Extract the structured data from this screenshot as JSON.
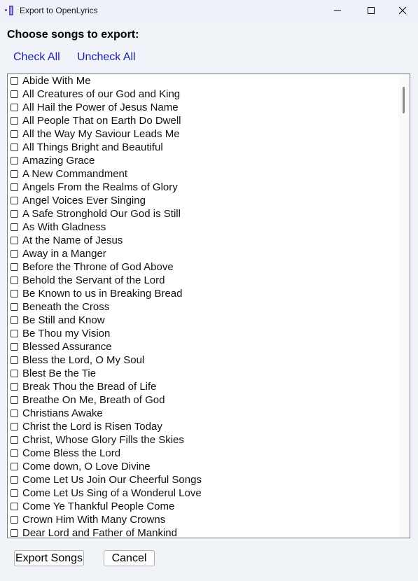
{
  "window": {
    "title": "Export to OpenLyrics"
  },
  "heading": "Choose songs to export:",
  "actions": {
    "check_all": "Check All",
    "uncheck_all": "Uncheck All"
  },
  "songs": [
    {
      "label": "Abide With Me",
      "checked": false
    },
    {
      "label": "All Creatures of our God and King",
      "checked": false
    },
    {
      "label": "All Hail the Power of Jesus Name",
      "checked": false
    },
    {
      "label": "All People That on Earth Do Dwell",
      "checked": false
    },
    {
      "label": "All the Way My Saviour Leads Me",
      "checked": false
    },
    {
      "label": "All Things Bright and Beautiful",
      "checked": false
    },
    {
      "label": "Amazing Grace",
      "checked": false
    },
    {
      "label": "A New Commandment",
      "checked": false
    },
    {
      "label": "Angels From the Realms of Glory",
      "checked": false
    },
    {
      "label": "Angel Voices Ever Singing",
      "checked": false
    },
    {
      "label": "A Safe Stronghold Our God is Still",
      "checked": false
    },
    {
      "label": "As With Gladness",
      "checked": false
    },
    {
      "label": "At the Name of Jesus",
      "checked": false
    },
    {
      "label": "Away in a Manger",
      "checked": false
    },
    {
      "label": "Before the Throne of God Above",
      "checked": false
    },
    {
      "label": "Behold the Servant of the Lord",
      "checked": false
    },
    {
      "label": "Be Known to us in Breaking Bread",
      "checked": false
    },
    {
      "label": "Beneath the Cross",
      "checked": false
    },
    {
      "label": "Be Still and Know",
      "checked": false
    },
    {
      "label": "Be Thou my Vision",
      "checked": false
    },
    {
      "label": "Blessed Assurance",
      "checked": false
    },
    {
      "label": "Bless the Lord, O My Soul",
      "checked": false
    },
    {
      "label": "Blest Be the Tie",
      "checked": false
    },
    {
      "label": "Break Thou the Bread of Life",
      "checked": false
    },
    {
      "label": "Breathe On Me, Breath of God",
      "checked": false
    },
    {
      "label": "Christians Awake",
      "checked": false
    },
    {
      "label": "Christ the Lord is Risen Today",
      "checked": false
    },
    {
      "label": "Christ, Whose Glory Fills the Skies",
      "checked": false
    },
    {
      "label": "Come Bless the Lord",
      "checked": false
    },
    {
      "label": "Come down, O Love Divine",
      "checked": false
    },
    {
      "label": "Come Let Us Join Our Cheerful Songs",
      "checked": false
    },
    {
      "label": "Come Let Us Sing of a Wonderul Love",
      "checked": false
    },
    {
      "label": "Come Ye Thankful People Come",
      "checked": false
    },
    {
      "label": "Crown Him With Many Crowns",
      "checked": false
    },
    {
      "label": "Dear Lord and Father of Mankind",
      "checked": false
    }
  ],
  "buttons": {
    "export": "Export Songs",
    "cancel": "Cancel"
  },
  "icons": {
    "app": "app-icon",
    "minimize": "minimize-icon",
    "maximize": "maximize-icon",
    "close": "close-icon"
  },
  "colors": {
    "link": "#1e22a8",
    "background": "#f0f3f8",
    "titlebar": "#eef2f8"
  }
}
